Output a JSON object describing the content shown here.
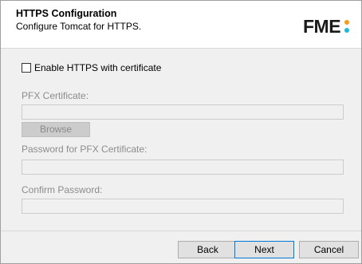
{
  "header": {
    "title": "HTTPS Configuration",
    "subtitle": "Configure Tomcat for HTTPS.",
    "logo_text": "FME",
    "logo_colors": {
      "top_dot": "#f59c1a",
      "bottom_dot": "#21b8d8"
    }
  },
  "form": {
    "enable_https": {
      "label": "Enable HTTPS with certificate",
      "checked": false
    },
    "pfx_certificate": {
      "label": "PFX Certificate:",
      "value": ""
    },
    "browse_label": "Browse",
    "pfx_password": {
      "label": "Password for PFX Certificate:",
      "value": ""
    },
    "confirm_password": {
      "label": "Confirm Password:",
      "value": ""
    }
  },
  "footer": {
    "back_label": "Back",
    "next_label": "Next",
    "cancel_label": "Cancel"
  }
}
